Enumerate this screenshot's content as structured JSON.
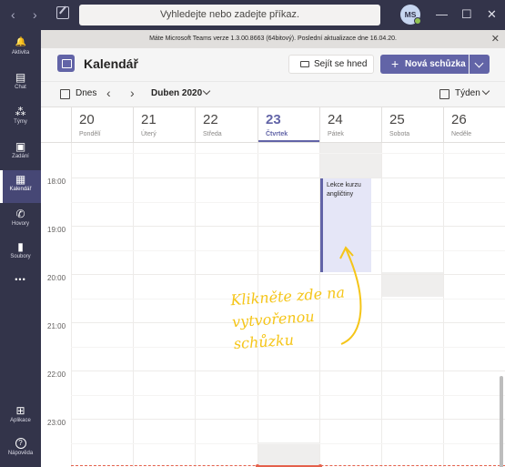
{
  "titlebar": {
    "search_placeholder": "Vyhledejte nebo zadejte příkaz.",
    "avatar_initials": "MS",
    "presence_color": "#92c353",
    "back": "‹",
    "forward": "›",
    "minimize": "—",
    "maximize": "☐",
    "close": "✕"
  },
  "rail": {
    "items": [
      {
        "label": "Aktivita",
        "icon": "bell-icon",
        "glyph": "🔔"
      },
      {
        "label": "Chat",
        "icon": "chat-icon",
        "glyph": "▤"
      },
      {
        "label": "Týmy",
        "icon": "teams-icon",
        "glyph": "⁂"
      },
      {
        "label": "Zadání",
        "icon": "assignments-icon",
        "glyph": "▣"
      },
      {
        "label": "Kalendář",
        "icon": "calendar-icon",
        "glyph": "▦"
      },
      {
        "label": "Hovory",
        "icon": "phone-icon",
        "glyph": "✆"
      },
      {
        "label": "Soubory",
        "icon": "files-icon",
        "glyph": "▮"
      },
      {
        "label": "",
        "icon": "more-icon",
        "glyph": "•••"
      },
      {
        "label": "Aplikace",
        "icon": "apps-icon",
        "glyph": "⊞"
      },
      {
        "label": "Nápověda",
        "icon": "help-icon",
        "glyph": "?"
      }
    ],
    "active_color": "#464775"
  },
  "banner": {
    "text": "Máte Microsoft Teams verze 1.3.00.8663 (64bitový). Poslední aktualizace dne 16.04.20.",
    "close": "✕"
  },
  "header": {
    "title": "Kalendář",
    "meet_now": "Sejít se hned",
    "new_meeting": "Nová schůzka",
    "plus": "+"
  },
  "toolbar": {
    "today": "Dnes",
    "prev": "‹",
    "next": "›",
    "month": "Duben 2020",
    "view": "Týden"
  },
  "calendar": {
    "days": [
      {
        "num": "20",
        "name": "Pondělí",
        "today": false
      },
      {
        "num": "21",
        "name": "Úterý",
        "today": false
      },
      {
        "num": "22",
        "name": "Středa",
        "today": false
      },
      {
        "num": "23",
        "name": "Čtvrtek",
        "today": true
      },
      {
        "num": "24",
        "name": "Pátek",
        "today": false
      },
      {
        "num": "25",
        "name": "Sobota",
        "today": false
      },
      {
        "num": "26",
        "name": "Neděle",
        "today": false
      }
    ],
    "hours": [
      "18:00",
      "19:00",
      "20:00",
      "21:00",
      "22:00",
      "23:00"
    ],
    "event": {
      "title": "Lekce kurzu angličtiny",
      "day": "Pátek",
      "start": "18:00",
      "end": "20:00"
    },
    "annotation": "Klikněte zde na vytvořenou schůzku",
    "accent_color": "#6264a7",
    "annotation_color": "#f5c518"
  }
}
